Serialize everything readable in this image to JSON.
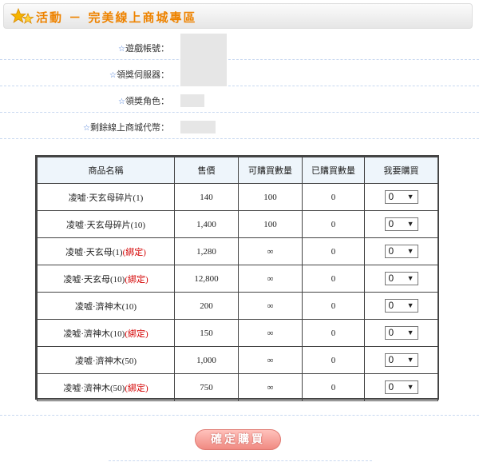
{
  "header": {
    "title": "活動 － 完美線上商城專區"
  },
  "info": {
    "account_label": "遊戲帳號：",
    "server_label": "領獎伺服器：",
    "character_label": "領獎角色：",
    "points_label": "剩餘線上商城代幣："
  },
  "table": {
    "headers": [
      "商品名稱",
      "售價",
      "可購買數量",
      "已購買數量",
      "我要購買"
    ],
    "rows": [
      {
        "name": "凌嘘·天玄母碎片(1)",
        "bound": "",
        "price": "140",
        "limit": "100",
        "bought": "0",
        "qty": "0"
      },
      {
        "name": "凌嘘·天玄母碎片(10)",
        "bound": "",
        "price": "1,400",
        "limit": "100",
        "bought": "0",
        "qty": "0"
      },
      {
        "name": "凌嘘·天玄母(1)",
        "bound": "(綁定)",
        "price": "1,280",
        "limit": "∞",
        "bought": "0",
        "qty": "0"
      },
      {
        "name": "凌嘘·天玄母(10)",
        "bound": "(綁定)",
        "price": "12,800",
        "limit": "∞",
        "bought": "0",
        "qty": "0"
      },
      {
        "name": "凌嘘·濟神木(10)",
        "bound": "",
        "price": "200",
        "limit": "∞",
        "bought": "0",
        "qty": "0"
      },
      {
        "name": "凌嘘·濟神木(10)",
        "bound": "(綁定)",
        "price": "150",
        "limit": "∞",
        "bought": "0",
        "qty": "0"
      },
      {
        "name": "凌嘘·濟神木(50)",
        "bound": "",
        "price": "1,000",
        "limit": "∞",
        "bought": "0",
        "qty": "0"
      },
      {
        "name": "凌嘘·濟神木(50)",
        "bound": "(綁定)",
        "price": "750",
        "limit": "∞",
        "bought": "0",
        "qty": "0"
      }
    ]
  },
  "footer": {
    "confirm_label": "確定購買"
  },
  "colors": {
    "accent": "#ee8300",
    "bound": "#d40000",
    "button": "#f08a82"
  }
}
